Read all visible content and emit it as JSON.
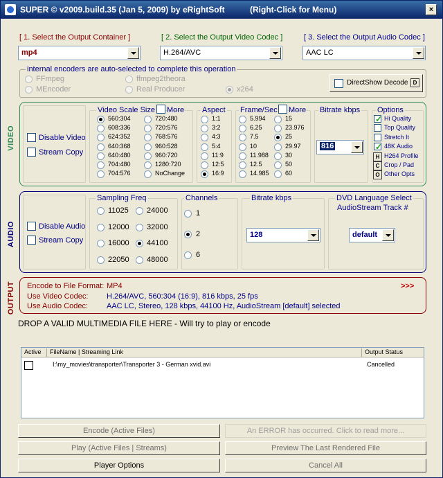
{
  "window": {
    "title": "SUPER © v2009.build.35 (Jan 5, 2009) by eRightSoft",
    "hint": "(Right-Click for Menu)"
  },
  "steps": {
    "container_label": "[ 1.    Select the Output Container ]",
    "container_value": "mp4",
    "video_codec_label": "[ 2.   Select the Output Video Codec ]",
    "video_codec_value": "H.264/AVC",
    "audio_codec_label": "[ 3.   Select the Output Audio Codec ]",
    "audio_codec_value": "AAC LC"
  },
  "encoders": {
    "caption": "internal encoders are auto-selected to complete this operation",
    "options": [
      "FFmpeg",
      "ffmpeg2theora",
      "MEncoder",
      "Real Producer",
      "x264"
    ],
    "selected": "x264",
    "directshow_label": "DirectShow Decode",
    "directshow_key": "D"
  },
  "video": {
    "side_label": "VIDEO",
    "disable_label": "Disable Video",
    "stream_copy_label": "Stream Copy",
    "scale_caption": "Video Scale Size",
    "more_label": "More",
    "scale_options": [
      "560:304",
      "720:480",
      "608:336",
      "720:576",
      "624:352",
      "768:576",
      "640:368",
      "960:528",
      "640:480",
      "960:720",
      "704:480",
      "1280:720",
      "704:576",
      "NoChange"
    ],
    "scale_selected": "560:304",
    "aspect_caption": "Aspect",
    "aspect_options": [
      "1:1",
      "3:2",
      "4:3",
      "5:4",
      "11:9",
      "12:5",
      "16:9"
    ],
    "aspect_selected": "16:9",
    "fps_caption": "Frame/Sec",
    "fps_more_label": "More",
    "fps_options": [
      "5.994",
      "15",
      "6.25",
      "23.976",
      "7.5",
      "25",
      "10",
      "29.97",
      "11.988",
      "30",
      "12.5",
      "50",
      "14.985",
      "60"
    ],
    "fps_selected": "25",
    "bitrate_caption": "Bitrate  kbps",
    "bitrate_value": "816",
    "options_caption": "Options",
    "options": [
      {
        "label": "Hi Quality",
        "type": "check",
        "on": true
      },
      {
        "label": "Top Quality",
        "type": "check",
        "on": false
      },
      {
        "label": "Stretch It",
        "type": "check",
        "on": false
      },
      {
        "label": "48K Audio",
        "type": "check",
        "on": true
      },
      {
        "label": "H264 Profile",
        "type": "key",
        "key": "H"
      },
      {
        "label": "Crop / Pad",
        "type": "key",
        "key": "C"
      },
      {
        "label": "Other Opts",
        "type": "key",
        "key": "O"
      }
    ]
  },
  "audio": {
    "side_label": "AUDIO",
    "disable_label": "Disable Audio",
    "stream_copy_label": "Stream Copy",
    "freq_caption": "Sampling Freq",
    "freq_options": [
      "11025",
      "24000",
      "12000",
      "32000",
      "16000",
      "44100",
      "22050",
      "48000"
    ],
    "freq_selected": "44100",
    "channels_caption": "Channels",
    "channels_options": [
      "1",
      "2",
      "6"
    ],
    "channels_selected": "2",
    "bitrate_caption": "Bitrate  kbps",
    "bitrate_value": "128",
    "dvd_caption_line1": "DVD Language Select",
    "dvd_caption_line2": "AudioStream  Track #",
    "dvd_value": "default"
  },
  "output": {
    "side_label": "OUTPUT",
    "format_key": "Encode to File Format:",
    "format_value": "MP4",
    "more": ">>>",
    "video_key": "Use Video Codec:",
    "video_value": "H.264/AVC,  560:304 (16:9),  816 kbps,  25 fps",
    "audio_key": "Use Audio Codec:",
    "audio_value": "AAC LC,  Stereo,  128 kbps,  44100 Hz,  AudioStream [default] selected"
  },
  "drop_hint": "DROP A VALID MULTIMEDIA FILE HERE - Will try to play or encode",
  "files": {
    "columns": [
      "Active",
      "FileName  |  Streaming Link",
      "Output Status"
    ],
    "rows": [
      {
        "active": false,
        "name": "I:\\my_movies\\transporter\\Transporter 3 - German xvid.avi",
        "status": "Cancelled"
      }
    ]
  },
  "buttons": {
    "encode": "Encode (Active Files)",
    "error": "An ERROR has occurred. Click to read more...",
    "play": "Play (Active Files | Streams)",
    "preview": "Preview The Last Rendered File",
    "player_options": "Player Options",
    "cancel_all": "Cancel All"
  }
}
